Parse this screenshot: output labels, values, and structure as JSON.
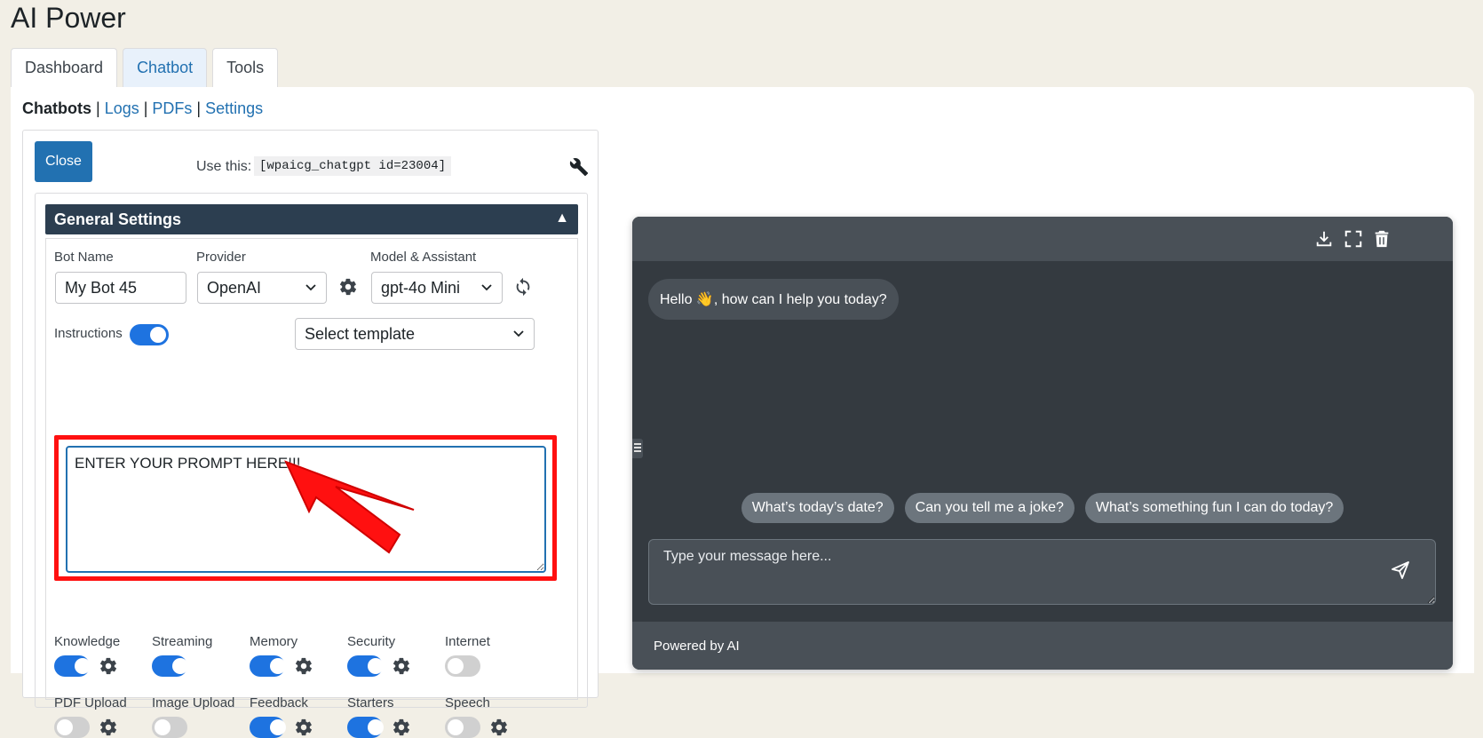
{
  "page": {
    "title": "AI Power"
  },
  "tabs": [
    {
      "label": "Dashboard"
    },
    {
      "label": "Chatbot"
    },
    {
      "label": "Tools"
    }
  ],
  "subnav": {
    "current": "Chatbots",
    "sep": "|",
    "links": [
      "Logs",
      "PDFs",
      "Settings"
    ]
  },
  "editor": {
    "close_label": "Close",
    "use_this_label": "Use this:",
    "shortcode": "[wpaicg_chatgpt id=23004]"
  },
  "general": {
    "header": "General Settings",
    "caret": "▲",
    "bot_name_label": "Bot Name",
    "bot_name_value": "My Bot 45",
    "provider_label": "Provider",
    "provider_value": "OpenAI",
    "model_label": "Model & Assistant",
    "model_value": "gpt-4o Mini",
    "instructions_label": "Instructions",
    "instructions_on": true,
    "template_value": "Select template",
    "prompt_value": "ENTER YOUR PROMPT HERE!!!"
  },
  "features_row1": [
    {
      "label": "Knowledge",
      "on": true,
      "gear": true
    },
    {
      "label": "Streaming",
      "on": true,
      "gear": false
    },
    {
      "label": "Memory",
      "on": true,
      "gear": true
    },
    {
      "label": "Security",
      "on": true,
      "gear": true
    },
    {
      "label": "Internet",
      "on": false,
      "gear": false
    }
  ],
  "features_row2": [
    {
      "label": "PDF Upload",
      "on": false,
      "gear": true
    },
    {
      "label": "Image Upload",
      "on": false,
      "gear": false
    },
    {
      "label": "Feedback",
      "on": true,
      "gear": true
    },
    {
      "label": "Starters",
      "on": true,
      "gear": true
    },
    {
      "label": "Speech",
      "on": false,
      "gear": true
    }
  ],
  "chat": {
    "greeting": "Hello 👋, how can I help you today?",
    "starters": [
      "What’s today’s date?",
      "Can you tell me a joke?",
      "What’s something fun I can do today?"
    ],
    "input_placeholder": "Type your message here...",
    "footer": "Powered by AI"
  },
  "colors": {
    "accent": "#2271b1",
    "toggle_on": "#1e73e0",
    "chat_bg": "#343a40",
    "highlight": "#ff1010"
  }
}
